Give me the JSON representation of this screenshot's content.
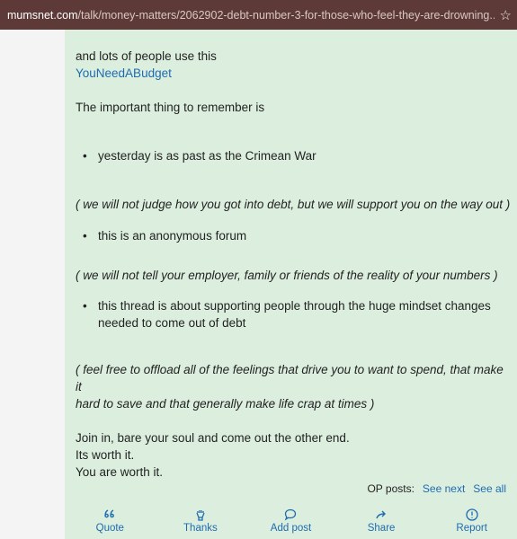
{
  "browser": {
    "url_host": "mumsnet.com",
    "url_path": "/talk/money-matters/2062902-debt-number-3-for-those-who-feel-they-are-drowning...",
    "bookmark_icon": "star-icon"
  },
  "post": {
    "intro": "and lots of people use this",
    "link_text": "YouNeedABudget",
    "important": "The important thing to remember is",
    "bullet1": "yesterday is as past as the Crimean War",
    "note1": "( we will not judge how you got into debt, but we will support you on the way out )",
    "bullet2": "this is an anonymous forum",
    "note2": "( we will not tell your employer, family or friends of the reality of your numbers )",
    "bullet3_line1": "this thread is about supporting people through the huge mindset changes",
    "bullet3_line2": "needed to come out of debt",
    "note3_line1": "( feel free to offload all of the feelings that drive you to want to spend, that make it",
    "note3_line2": "hard to save and that generally make life crap at times )",
    "closing1": "Join in, bare your soul and come out the other end.",
    "closing2": "Its worth it.",
    "closing3": "You are worth it."
  },
  "op_posts": {
    "label": "OP posts:",
    "see_next": "See next",
    "see_all": "See all"
  },
  "actions": [
    {
      "label": "Quote",
      "icon": "quote-icon"
    },
    {
      "label": "Thanks",
      "icon": "thanks-hands-icon"
    },
    {
      "label": "Add post",
      "icon": "speech-bubble-icon"
    },
    {
      "label": "Share",
      "icon": "share-arrow-icon"
    },
    {
      "label": "Report",
      "icon": "alert-circle-icon"
    }
  ],
  "colors": {
    "urlbar_bg": "#5d3a37",
    "post_bg": "#dcefdf",
    "link": "#1e6bb0"
  }
}
